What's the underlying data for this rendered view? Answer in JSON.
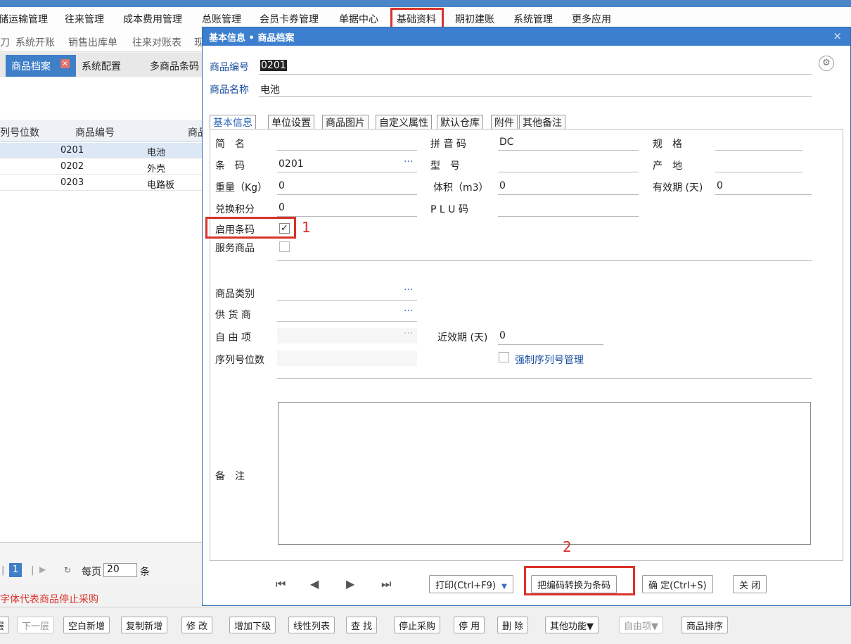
{
  "top_menu": [
    "储运输管理",
    "往来管理",
    "成本费用管理",
    "总账管理",
    "会员卡券管理",
    "单据中心",
    "基础资料",
    "期初建账",
    "系统管理",
    "更多应用"
  ],
  "sub_menu": [
    "刀",
    "系统开账",
    "销售出库单",
    "往来对账表",
    "现"
  ],
  "tabs": [
    "商品档案",
    "系统配置",
    "多商品条码"
  ],
  "grid": {
    "headers": [
      "列号位数",
      "商品编号",
      "商品"
    ],
    "rows": [
      {
        "code": "0201",
        "name": "电池"
      },
      {
        "code": "0202",
        "name": "外壳"
      },
      {
        "code": "0203",
        "name": "电路板"
      }
    ]
  },
  "pager": {
    "page": "1",
    "per_page_label": "每页",
    "per_page_value": "20",
    "unit": "条",
    "note": "字体代表商品停止采购"
  },
  "toolbar": [
    "层",
    "下一层",
    "空白新增",
    "复制新增",
    "修 改",
    "增加下级",
    "线性列表",
    "查 找",
    "停止采购",
    "停 用",
    "删 除",
    "其他功能▼",
    "自由项▼",
    "商品排序"
  ],
  "dialog": {
    "title": "基本信息 • 商品档案",
    "close": "×",
    "code_label": "商品编号",
    "code_value": "0201",
    "name_label": "商品名称",
    "name_value": "电池",
    "inner_tabs": [
      "基本信息",
      "单位设置",
      "商品图片",
      "自定义属性",
      "默认仓库",
      "附件",
      "其他备注"
    ],
    "fields": {
      "short_name": {
        "label": "简　名",
        "value": ""
      },
      "pinyin": {
        "label": "拼 音 码",
        "value": "DC"
      },
      "spec": {
        "label": "规　格",
        "value": ""
      },
      "barcode": {
        "label": "条　码",
        "value": "0201"
      },
      "model": {
        "label": "型　号",
        "value": ""
      },
      "origin": {
        "label": "产　地",
        "value": ""
      },
      "weight": {
        "label": "重量（Kg）",
        "value": "0"
      },
      "volume": {
        "label": "体积（m3）",
        "value": "0"
      },
      "validity": {
        "label": "有效期 (天)",
        "value": "0"
      },
      "points": {
        "label": "兑换积分",
        "value": "0"
      },
      "plu": {
        "label": "P L U 码",
        "value": ""
      },
      "enable_barcode": {
        "label": "启用条码",
        "checked": "✓"
      },
      "service_goods": {
        "label": "服务商品"
      },
      "category": {
        "label": "商品类别",
        "value": ""
      },
      "supplier": {
        "label": "供 货 商",
        "value": ""
      },
      "free_item": {
        "label": "自 由 项",
        "value": ""
      },
      "near_expiry": {
        "label": "近效期 (天)",
        "value": "0"
      },
      "serial_digits": {
        "label": "序列号位数",
        "value": ""
      },
      "force_serial": {
        "label": "强制序列号管理"
      },
      "remark": {
        "label": "备　注",
        "value": ""
      }
    },
    "annotations": [
      "1",
      "2"
    ],
    "buttons": {
      "print": "打印(Ctrl+F9)",
      "convert": "把编码转换为条码",
      "ok": "确 定(Ctrl+S)",
      "close": "关 闭"
    }
  },
  "colors": {
    "accent": "#3d7fcf",
    "highlight": "#d9322b"
  }
}
